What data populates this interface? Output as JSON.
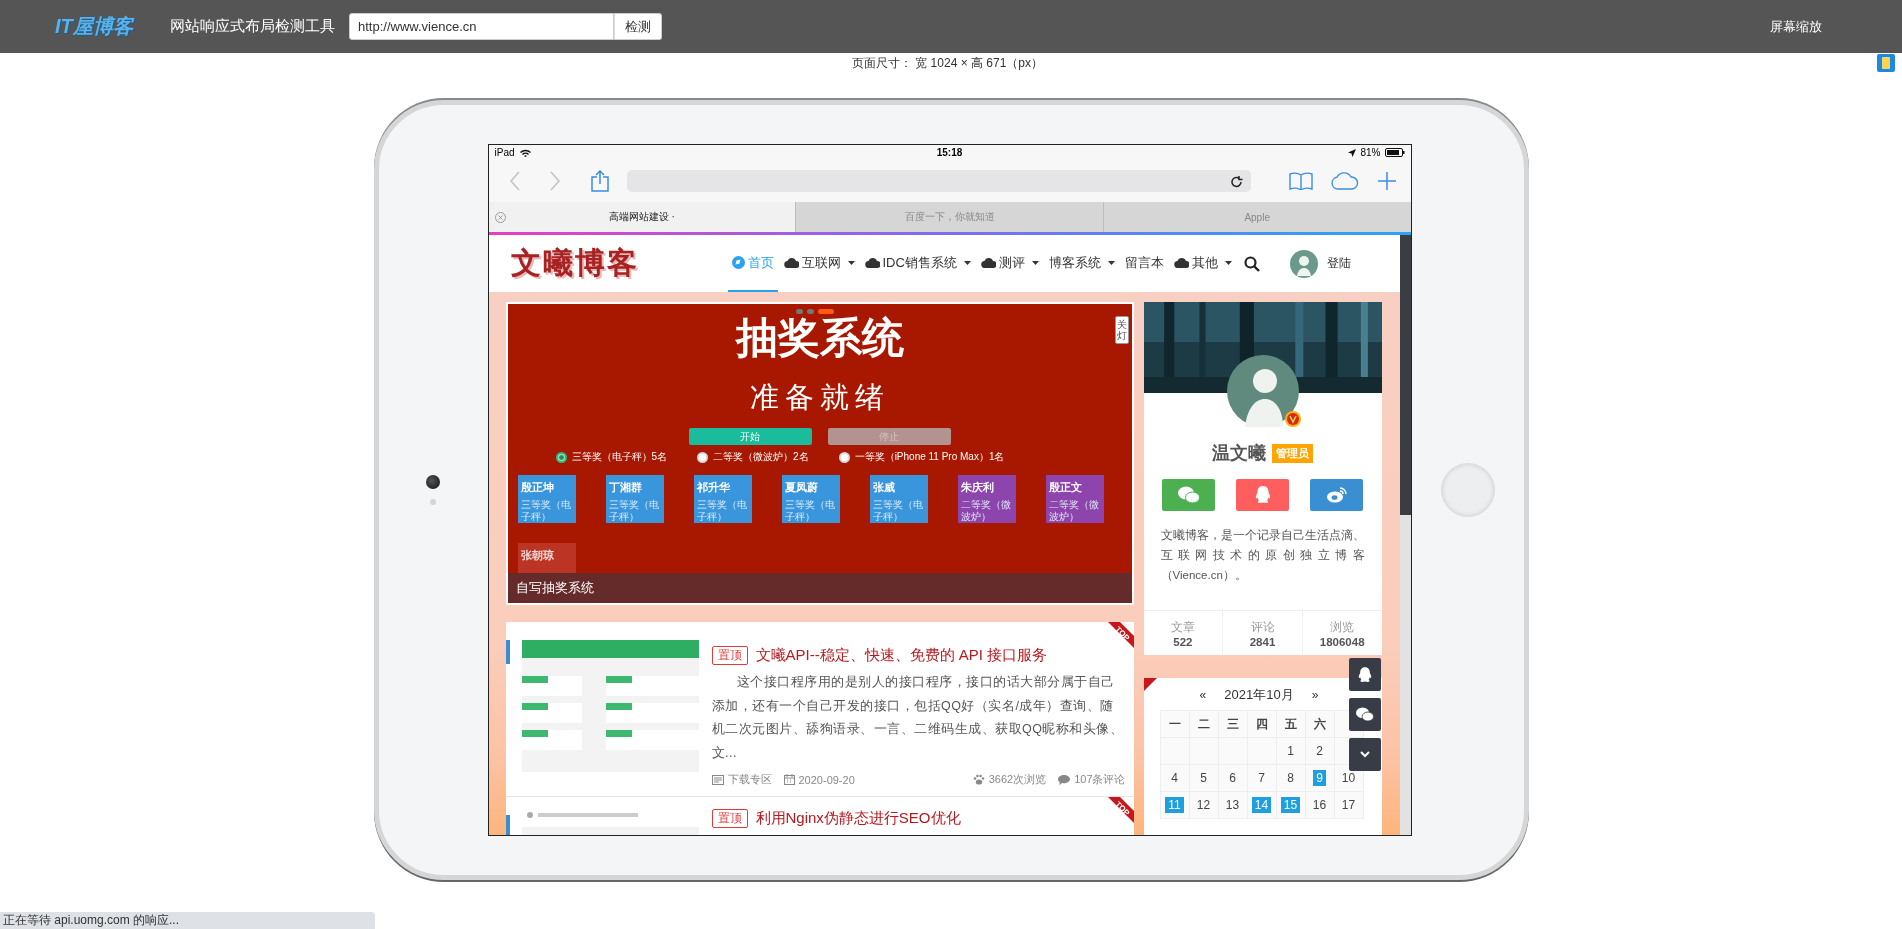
{
  "toolbar": {
    "logo": "IT屋博客",
    "title": "网站响应式布局检测工具",
    "url": "http://www.vience.cn",
    "check_button": "检测",
    "zoom_link": "屏幕缩放"
  },
  "page_size": "页面尺寸：  宽 1024 × 高 671（px）",
  "device": {
    "status_bar": {
      "device": "iPad",
      "time": "15:18",
      "battery": "81%"
    },
    "browser_tabs": [
      {
        "label": "高端网站建设 ·",
        "selected": true
      },
      {
        "label": "百度一下，你就知道",
        "selected": false
      },
      {
        "label": "Apple",
        "selected": false
      }
    ],
    "site": {
      "logo": "文曦博客",
      "login": "登陆",
      "nav": [
        {
          "label": "首页",
          "kind": "home",
          "selected": true,
          "dropdown": false
        },
        {
          "label": "互联网",
          "kind": "cloud",
          "selected": false,
          "dropdown": true
        },
        {
          "label": "IDC销售系统",
          "kind": "cloud",
          "selected": false,
          "dropdown": true
        },
        {
          "label": "测评",
          "kind": "cloud",
          "selected": false,
          "dropdown": true
        },
        {
          "label": "博客系统",
          "kind": "plain",
          "selected": false,
          "dropdown": true
        },
        {
          "label": "留言本",
          "kind": "plain",
          "selected": false,
          "dropdown": false
        },
        {
          "label": "其他",
          "kind": "cloud",
          "selected": false,
          "dropdown": true
        }
      ],
      "banner": {
        "slides": [
          {
            "selected": false
          },
          {
            "selected": false
          },
          {
            "selected": true
          }
        ],
        "caption": "自写抽奖系统",
        "light_toggle": "关灯",
        "screen": {
          "title": "抽奖系统",
          "status": "准备就绪",
          "buttons": [
            {
              "label": "开始",
              "disabled": false
            },
            {
              "label": "停止",
              "disabled": true
            }
          ],
          "prizes": [
            {
              "label": "三等奖（电子秤）5名",
              "selected": true
            },
            {
              "label": "二等奖（微波炉）2名",
              "selected": false
            },
            {
              "label": "一等奖（iPhone 11 Pro Max）1名",
              "selected": false
            }
          ],
          "winners": [
            {
              "name": "殷正坤",
              "prize": "三等奖（电子秤）",
              "color": "#3a96dc"
            },
            {
              "name": "丁湘群",
              "prize": "三等奖（电子秤）",
              "color": "#3a96dc"
            },
            {
              "name": "祁升华",
              "prize": "三等奖（电子秤）",
              "color": "#3a96dc"
            },
            {
              "name": "夏凤蔚",
              "prize": "三等奖（电子秤）",
              "color": "#3a96dc"
            },
            {
              "name": "张威",
              "prize": "三等奖（电子秤）",
              "color": "#3a96dc"
            },
            {
              "name": "朱庆利",
              "prize": "二等奖（微波炉）",
              "color": "#8e44ad"
            },
            {
              "name": "殷正文",
              "prize": "二等奖（微波炉）",
              "color": "#8e44ad"
            },
            {
              "name": "张朝琼",
              "color": "#c0392b"
            }
          ]
        }
      },
      "posts": [
        {
          "tag": "置顶",
          "ribbon": "TOP",
          "title": "文曦API--稳定、快速、免费的 API 接口服务",
          "excerpt": "这个接口程序用的是别人的接口程序，接口的话大部分属于自己添加，还有一个自己开发的接口，包括QQ好（实名/成年）查询、随机二次元图片、舔狗语录、一言、二维码生成、获取QQ昵称和头像、文...",
          "category": "下载专区",
          "date": "2020-09-20",
          "views": "3662次浏览",
          "comments": "107条评论"
        },
        {
          "tag": "置顶",
          "ribbon": "TOP",
          "title": "利用Nginx伪静态进行SEO优化"
        }
      ],
      "profile": {
        "name": "温文曦",
        "role": "管理员",
        "verified": true,
        "bio": "文曦博客，是一个记录自己生活点滴、互联网技术的原创独立博客（Vience.cn）。",
        "stats": [
          {
            "label": "文章",
            "value": "522"
          },
          {
            "label": "评论",
            "value": "2841"
          },
          {
            "label": "浏览",
            "value": "1806048"
          }
        ]
      },
      "calendar": {
        "prev": "«",
        "title": "2021年10月",
        "next": "»",
        "weekdays": [
          "一",
          "二",
          "三",
          "四",
          "五",
          "六"
        ],
        "weeks": [
          [
            {
              "kind": "blank"
            },
            {
              "kind": "blank"
            },
            {
              "kind": "blank"
            },
            {
              "kind": "blank"
            },
            {
              "kind": "day",
              "day": "1",
              "marked": false
            },
            {
              "kind": "day",
              "day": "2",
              "marked": false
            }
          ],
          [
            {
              "day": "4",
              "marked": false
            },
            {
              "day": "5",
              "marked": false
            },
            {
              "day": "6",
              "marked": false
            },
            {
              "day": "7",
              "marked": false
            },
            {
              "day": "8",
              "marked": false
            },
            {
              "day": "9",
              "marked": true
            },
            {
              "day": "10",
              "marked": false
            }
          ],
          [
            {
              "day": "11",
              "marked": true
            },
            {
              "day": "12",
              "marked": false
            },
            {
              "day": "13",
              "marked": false
            },
            {
              "day": "14",
              "marked": true
            },
            {
              "day": "15",
              "marked": true
            },
            {
              "day": "16",
              "marked": false
            },
            {
              "day": "17",
              "marked": false
            }
          ]
        ]
      }
    }
  },
  "status_text": "正在等待 api.uomg.com 的响应..."
}
